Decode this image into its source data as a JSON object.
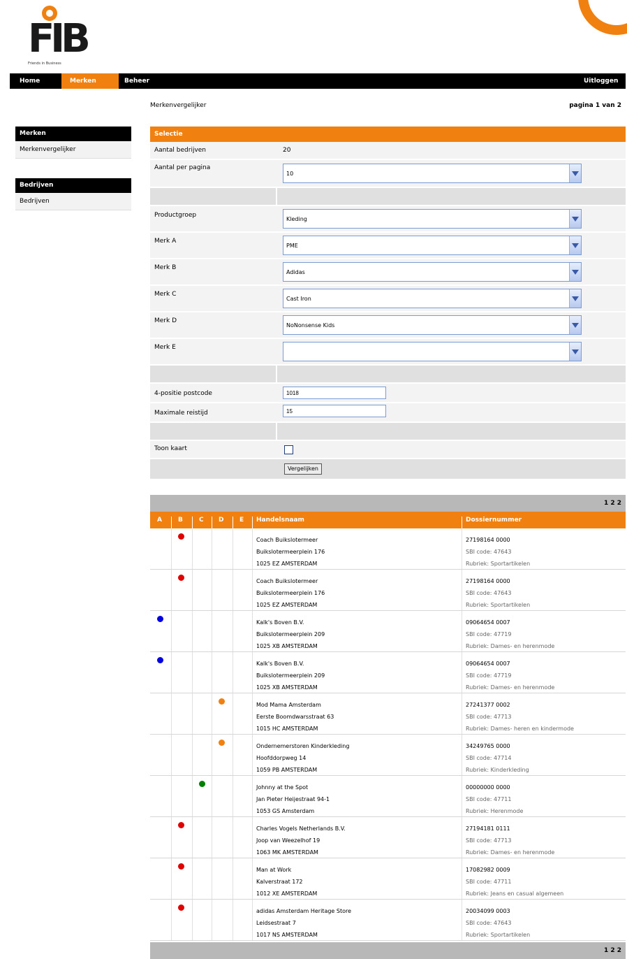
{
  "logo": {
    "text": "FIB",
    "tagline": "Friends in Business",
    "colors": {
      "accent": "#f08010"
    }
  },
  "nav": {
    "items": [
      {
        "label": "Home",
        "active": false
      },
      {
        "label": "Merken",
        "active": true
      },
      {
        "label": "Beheer",
        "active": false
      }
    ],
    "logout": "Uitloggen"
  },
  "breadcrumb": "Merkenvergelijker",
  "page_indicator": "pagina 1 van 2",
  "sidebar": {
    "sections": [
      {
        "title": "Merken",
        "items": [
          "Merkenvergelijker"
        ]
      },
      {
        "title": "Bedrijven",
        "items": [
          "Bedrijven"
        ]
      }
    ]
  },
  "selection": {
    "title": "Selectie",
    "count_label": "Aantal bedrijven",
    "count_value": "20",
    "per_page_label": "Aantal per pagina",
    "per_page_value": "10",
    "productgroup_label": "Productgroep",
    "productgroup_value": "Kleding",
    "brands": [
      {
        "label": "Merk A",
        "value": "PME"
      },
      {
        "label": "Merk B",
        "value": "Adidas"
      },
      {
        "label": "Merk C",
        "value": "Cast Iron"
      },
      {
        "label": "Merk D",
        "value": "NoNonsense Kids"
      },
      {
        "label": "Merk E",
        "value": ""
      }
    ],
    "postcode_label": "4-positie postcode",
    "postcode_value": "1018",
    "distance_label": "Maximale reistijd",
    "distance_value": "15",
    "map_label": "Toon kaart",
    "submit_label": "Vergelijken"
  },
  "results": {
    "pager_top": "1 2 2",
    "pager_bottom": "1 2 2",
    "columns": [
      "A",
      "B",
      "C",
      "D",
      "E",
      "Handelsnaam",
      "Dossiernummer"
    ],
    "colors": {
      "red": "#e00000",
      "blue": "#0000e0",
      "orange": "#f08010",
      "green": "#008000"
    },
    "rows": [
      {
        "brand": "B",
        "color": "red",
        "name": "Coach Buikslotermeer",
        "street": "Buikslotermeerplein 176",
        "city": "1025 EZ AMSTERDAM",
        "dossier": "27198164 0000",
        "sbi": "SBI code: 47643",
        "rubriek": "Rubriek: Sportartikelen"
      },
      {
        "brand": "B",
        "color": "red",
        "name": "Coach Buikslotermeer",
        "street": "Buikslotermeerplein 176",
        "city": "1025 EZ AMSTERDAM",
        "dossier": "27198164 0000",
        "sbi": "SBI code: 47643",
        "rubriek": "Rubriek: Sportartikelen"
      },
      {
        "brand": "A",
        "color": "blue",
        "name": "Kalk's Boven B.V.",
        "street": "Buikslotermeerplein 209",
        "city": "1025 XB AMSTERDAM",
        "dossier": "09064654 0007",
        "sbi": "SBI code: 47719",
        "rubriek": "Rubriek: Dames- en herenmode"
      },
      {
        "brand": "A",
        "color": "blue",
        "name": "Kalk's Boven B.V.",
        "street": "Buikslotermeerplein 209",
        "city": "1025 XB AMSTERDAM",
        "dossier": "09064654 0007",
        "sbi": "SBI code: 47719",
        "rubriek": "Rubriek: Dames- en herenmode"
      },
      {
        "brand": "D",
        "color": "orange",
        "name": "Mod Mama Amsterdam",
        "street": "Eerste Boomdwarsstraat 63",
        "city": "1015 HC AMSTERDAM",
        "dossier": "27241377 0002",
        "sbi": "SBI code: 47713",
        "rubriek": "Rubriek: Dames- heren en kindermode"
      },
      {
        "brand": "D",
        "color": "orange",
        "name": "Ondernemerstoren Kinderkleding",
        "street": "Hoofddorpweg 14",
        "city": "1059 PB AMSTERDAM",
        "dossier": "34249765 0000",
        "sbi": "SBI code: 47714",
        "rubriek": "Rubriek: Kinderkleding"
      },
      {
        "brand": "C",
        "color": "green",
        "name": "Johnny at the Spot",
        "street": "Jan Pieter Heijestraat 94-1",
        "city": "1053 GS Amsterdam",
        "dossier": "00000000 0000",
        "sbi": "SBI code: 47711",
        "rubriek": "Rubriek: Herenmode"
      },
      {
        "brand": "B",
        "color": "red",
        "name": "Charles Vogels Netherlands B.V.",
        "street": "Joop van Weezelhof 19",
        "city": "1063 MK AMSTERDAM",
        "dossier": "27194181 0111",
        "sbi": "SBI code: 47713",
        "rubriek": "Rubriek: Dames- en herenmode"
      },
      {
        "brand": "B",
        "color": "red",
        "name": "Man at Work",
        "street": "Kalverstraat 172",
        "city": "1012 XE AMSTERDAM",
        "dossier": "17082982 0009",
        "sbi": "SBI code: 47711",
        "rubriek": "Rubriek: Jeans en casual algemeen"
      },
      {
        "brand": "B",
        "color": "red",
        "name": "adidas Amsterdam Heritage Store",
        "street": "Leidsestraat 7",
        "city": "1017 NS AMSTERDAM",
        "dossier": "20034099 0003",
        "sbi": "SBI code: 47643",
        "rubriek": "Rubriek: Sportartikelen"
      }
    ]
  }
}
